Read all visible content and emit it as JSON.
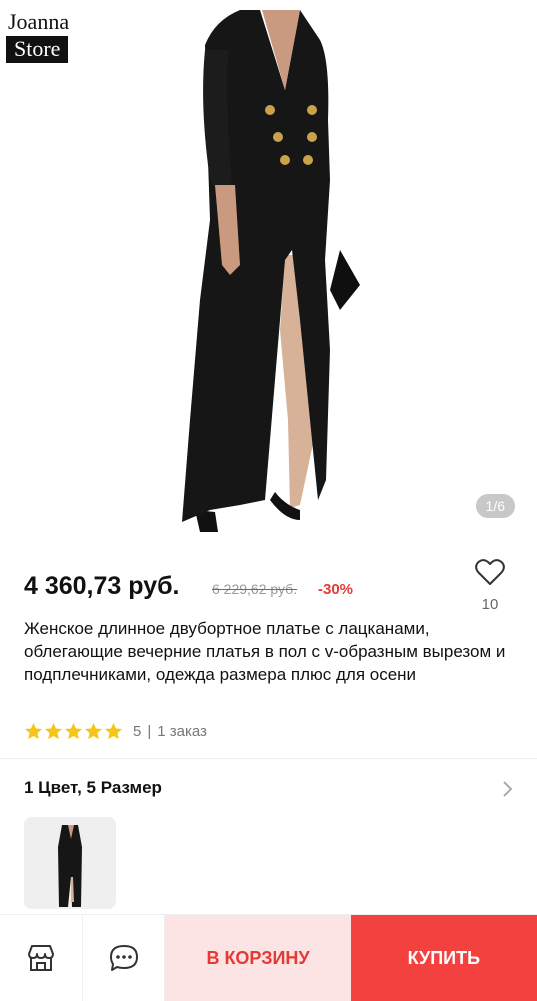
{
  "brand": {
    "line1": "Joanna",
    "line2": "Store"
  },
  "gallery": {
    "counter": "1/6"
  },
  "price": {
    "current": "4 360,73 руб.",
    "old": "6 229,62 руб.",
    "discount": "-30%"
  },
  "wishlist": {
    "count": "10",
    "icon": "heart-outline-icon"
  },
  "product": {
    "title": "Женское длинное двубортное платье с лацканами, облегающие вечерние платья в пол с v-образным вырезом и подплечниками, одежда размера плюс для осени"
  },
  "rating": {
    "stars": 5,
    "value": "5",
    "orders": "1 заказ",
    "star_color": "#f5c518"
  },
  "variants": {
    "label": "1 Цвет, 5 Размер"
  },
  "bottom_bar": {
    "store_icon": "store-icon",
    "chat_icon": "chat-icon",
    "cart_label": "В КОРЗИНУ",
    "buy_label": "КУПИТЬ"
  },
  "colors": {
    "accent": "#f2413e",
    "accent_light": "#fde4e4",
    "discount": "#e53935"
  }
}
